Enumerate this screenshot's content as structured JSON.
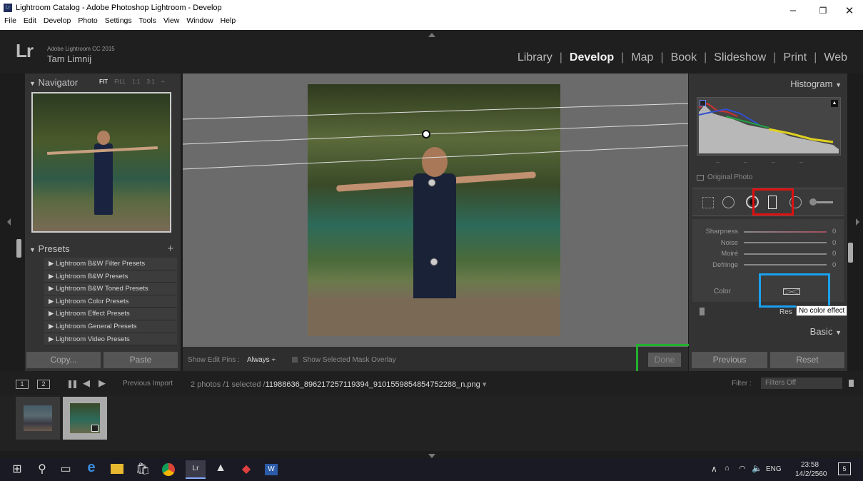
{
  "window": {
    "title": "Lightroom Catalog - Adobe Photoshop Lightroom - Develop",
    "menu": [
      "File",
      "Edit",
      "Develop",
      "Photo",
      "Settings",
      "Tools",
      "View",
      "Window",
      "Help"
    ]
  },
  "identity": {
    "logo": "Lr",
    "product": "Adobe Lightroom CC 2015",
    "user": "Tam Limnij"
  },
  "modules": [
    "Library",
    "Develop",
    "Map",
    "Book",
    "Slideshow",
    "Print",
    "Web"
  ],
  "navigator": {
    "title": "Navigator",
    "zoom_options": [
      "FIT",
      "FILL",
      "1:1",
      "3:1 ÷"
    ]
  },
  "presets": {
    "title": "Presets",
    "items": [
      "Lightroom B&W Filter Presets",
      "Lightroom B&W Presets",
      "Lightroom B&W Toned Presets",
      "Lightroom Color Presets",
      "Lightroom Effect Presets",
      "Lightroom General Presets",
      "Lightroom Video Presets"
    ]
  },
  "left_buttons": {
    "copy": "Copy...",
    "paste": "Paste"
  },
  "toolbar": {
    "edit_pins_label": "Show Edit Pins :",
    "edit_pins_value": "Always ÷",
    "mask_overlay": "Show Selected Mask Overlay",
    "done": "Done"
  },
  "histogram": {
    "title": "Histogram",
    "original_photo": "Original Photo"
  },
  "detail": {
    "sliders": [
      {
        "label": "Sharpness",
        "value": "0"
      },
      {
        "label": "Noise",
        "value": "0"
      },
      {
        "label": "Moiré",
        "value": "0"
      },
      {
        "label": "Defringe",
        "value": "0"
      }
    ],
    "color_label": "Color",
    "reset_partial": "Res",
    "tooltip": "No color effect",
    "basic_title": "Basic"
  },
  "right_buttons": {
    "previous": "Previous",
    "reset": "Reset"
  },
  "filmstrip_bar": {
    "page1": "1",
    "page2": "2",
    "source": "Previous Import",
    "count": "2 photos /1 selected /",
    "filename": "11988636_896217257119394_9101559854854752288_n.png",
    "filter_label": "Filter :",
    "filter_value": "Filters Off"
  },
  "taskbar": {
    "lang": "ENG",
    "time": "23:58",
    "date": "14/2/2560",
    "notif_count": "5"
  },
  "colors": {
    "highlight_red": "#e01010",
    "highlight_blue": "#1aa0ee",
    "highlight_green": "#22b030"
  }
}
